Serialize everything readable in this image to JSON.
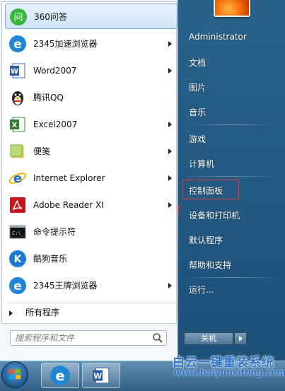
{
  "left_menu": {
    "items": [
      {
        "label": "360问答",
        "icon": "360-answer-icon",
        "has_arrow": false
      },
      {
        "label": "2345加速浏览器",
        "icon": "2345-browser-icon",
        "has_arrow": true
      },
      {
        "label": "Word2007",
        "icon": "word-icon",
        "has_arrow": true
      },
      {
        "label": "腾讯QQ",
        "icon": "qq-penguin-icon",
        "has_arrow": false
      },
      {
        "label": "Excel2007",
        "icon": "excel-icon",
        "has_arrow": true
      },
      {
        "label": "便笺",
        "icon": "sticky-notes-icon",
        "has_arrow": true
      },
      {
        "label": "Internet Explorer",
        "icon": "internet-explorer-icon",
        "has_arrow": true
      },
      {
        "label": "Adobe Reader XI",
        "icon": "adobe-reader-icon",
        "has_arrow": true
      },
      {
        "label": "命令提示符",
        "icon": "command-prompt-icon",
        "has_arrow": false
      },
      {
        "label": "酷狗音乐",
        "icon": "kugou-music-icon",
        "has_arrow": false
      },
      {
        "label": "2345王牌浏览器",
        "icon": "2345-browser-icon",
        "has_arrow": true
      }
    ],
    "all_programs": "所有程序"
  },
  "search": {
    "placeholder": "搜索程序和文件"
  },
  "right_menu": {
    "items": [
      {
        "label": "Administrator"
      },
      {
        "label": "文档"
      },
      {
        "label": "图片"
      },
      {
        "label": "音乐"
      },
      {
        "label": "游戏"
      },
      {
        "label": "计算机"
      },
      {
        "label": "控制面板",
        "highlighted": true
      },
      {
        "label": "设备和打印机"
      },
      {
        "label": "默认程序"
      },
      {
        "label": "帮助和支持"
      },
      {
        "label": "运行..."
      }
    ]
  },
  "shutdown": {
    "label": "关机"
  },
  "watermark": {
    "title": "白云一键重装系统",
    "url": "www.baiyunxitong.com"
  },
  "colors": {
    "highlight_box": "#e23a3a",
    "accent_blue": "#2f73c6"
  }
}
